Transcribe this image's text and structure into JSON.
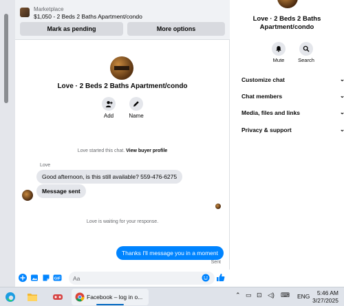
{
  "marketplace": {
    "label": "Marketplace",
    "listing": "$1,050 - 2 Beds 2 Baths Apartment/condo",
    "mark_pending": "Mark as pending",
    "more_options": "More options"
  },
  "profile": {
    "name": "Love · 2 Beds 2 Baths Apartment/condo",
    "add_label": "Add",
    "name_label": "Name"
  },
  "chat": {
    "started_text": "Love started this chat.",
    "view_profile": "View buyer profile",
    "sender": "Love",
    "messages_in": [
      "Good afternoon, is this still available? 559-476-6275",
      "Message sent"
    ],
    "waiting": "Love is waiting for your response.",
    "message_out": "Thanks I'll message you in a moment",
    "sent_status": "Sent",
    "input_placeholder": "Aa"
  },
  "info_panel": {
    "name": "Love · 2 Beds 2 Baths Apartment/condo",
    "mute_label": "Mute",
    "search_label": "Search",
    "sections": [
      "Customize chat",
      "Chat members",
      "Media, files and links",
      "Privacy & support"
    ]
  },
  "taskbar": {
    "app_label": "Facebook – log in o...",
    "lang": "ENG",
    "time": "5:46 AM",
    "date": "3/27/2025"
  },
  "colors": {
    "accent": "#0084ff",
    "bubble_in": "#e4e6eb",
    "panel_bg": "#ffffff",
    "page_bg": "#f0f2f5"
  }
}
